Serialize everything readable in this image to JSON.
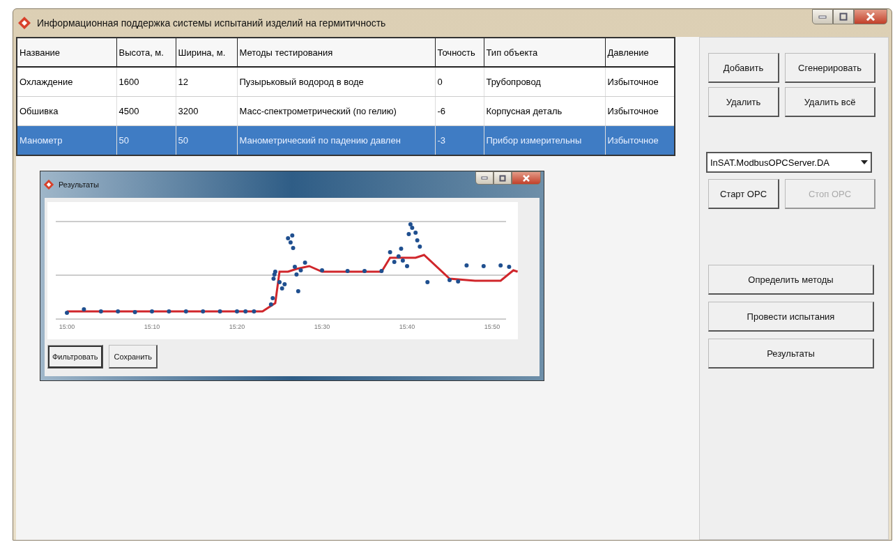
{
  "window": {
    "title": "Информационная поддержка системы испытаний изделий на гермитичность"
  },
  "table": {
    "columns": [
      "Название",
      "Высота, м.",
      "Ширина, м.",
      "Методы тестирования",
      "Точность",
      "Тип объекта",
      "Давление"
    ],
    "rows": [
      {
        "selected": false,
        "cells": [
          "Охлаждение",
          "1600",
          "12",
          "Пузырьковый водород в воде",
          "0",
          "Трубопровод",
          "Избыточное"
        ]
      },
      {
        "selected": false,
        "cells": [
          "Обшивка",
          "4500",
          "3200",
          "Масс-спектрометрический (по гелию)",
          "-6",
          "Корпусная деталь",
          "Избыточное"
        ]
      },
      {
        "selected": true,
        "cells": [
          "Манометр",
          "50",
          "50",
          "Манометрический по падению давлен",
          "-3",
          "Прибор измерительны",
          "Избыточное"
        ]
      }
    ]
  },
  "results_window": {
    "title": "Результаты",
    "x_tick_labels": [
      "15:00",
      "15:10",
      "15:20",
      "15:30",
      "15:40",
      "15:50"
    ],
    "buttons": [
      {
        "label": "Фильтровать",
        "focused": true
      },
      {
        "label": "Сохранить",
        "focused": false
      }
    ]
  },
  "side_panel": {
    "top_buttons": [
      {
        "label": "Добавить",
        "disabled": false
      },
      {
        "label": "Сгенерировать",
        "disabled": false
      },
      {
        "label": "Удалить",
        "disabled": false
      },
      {
        "label": "Удалить всё",
        "disabled": false
      }
    ],
    "server_dropdown": {
      "value": "InSAT.ModbusOPCServer.DA"
    },
    "opc_buttons": [
      {
        "label": "Старт OPC",
        "disabled": false
      },
      {
        "label": "Стоп OPC",
        "disabled": true
      }
    ],
    "action_buttons": [
      {
        "label": "Определить методы",
        "disabled": false
      },
      {
        "label": "Провести испытания",
        "disabled": false
      },
      {
        "label": "Результаты",
        "disabled": false
      }
    ]
  }
}
